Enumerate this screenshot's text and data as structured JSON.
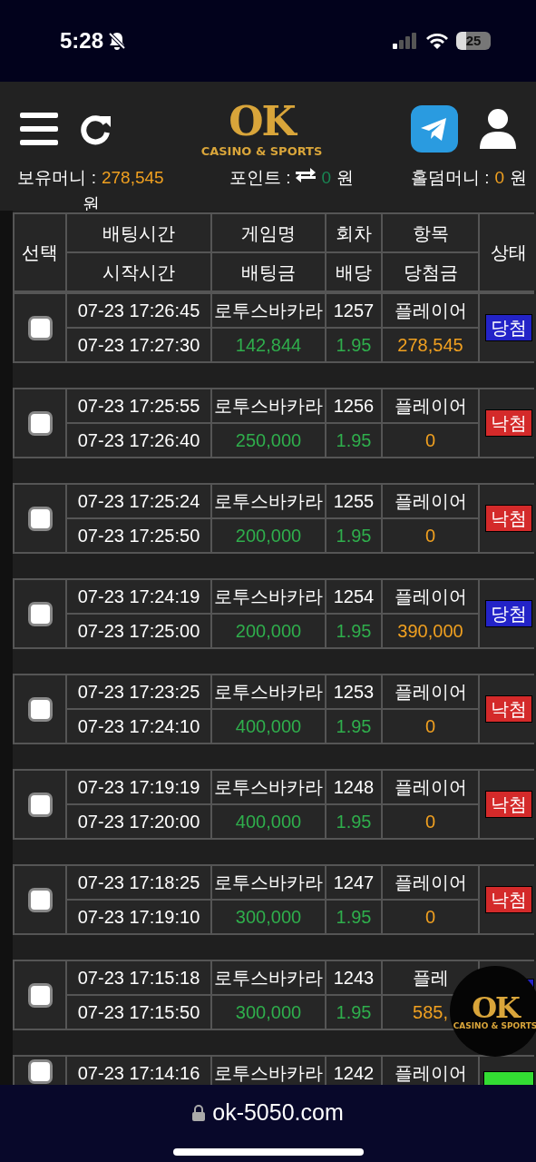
{
  "status_bar": {
    "time": "5:28",
    "battery": "25"
  },
  "header": {
    "logo": "OK",
    "logo_sub": "CASINO & SPORTS"
  },
  "balances": [
    {
      "label": "보유머니 :",
      "value": "278,545",
      "unit": "원",
      "kind": "money"
    },
    {
      "label": "포인트 :",
      "value": "0",
      "unit": "원",
      "kind": "point"
    },
    {
      "label": "홀덤머니 :",
      "value": "0",
      "unit": "원",
      "kind": "money"
    }
  ],
  "table": {
    "columns": {
      "select": "선택",
      "bet_time": "배팅시간",
      "start_time": "시작시간",
      "game": "게임명",
      "bet_amount": "배팅금",
      "round": "회차",
      "odds": "배당",
      "pick": "항목",
      "payout": "당첨금",
      "status": "상태"
    },
    "rows": [
      {
        "checked": false,
        "bet_time": "07-23 17:26:45",
        "start_time": "07-23 17:27:30",
        "game": "로투스바카라",
        "bet_amount": "142,844",
        "round": "1257",
        "odds": "1.95",
        "pick": "플레이어",
        "payout": "278,545",
        "status": {
          "kind": "win",
          "label": "당첨"
        }
      },
      {
        "checked": false,
        "bet_time": "07-23 17:25:55",
        "start_time": "07-23 17:26:40",
        "game": "로투스바카라",
        "bet_amount": "250,000",
        "round": "1256",
        "odds": "1.95",
        "pick": "플레이어",
        "payout": "0",
        "status": {
          "kind": "lose",
          "label": "낙첨"
        }
      },
      {
        "checked": false,
        "bet_time": "07-23 17:25:24",
        "start_time": "07-23 17:25:50",
        "game": "로투스바카라",
        "bet_amount": "200,000",
        "round": "1255",
        "odds": "1.95",
        "pick": "플레이어",
        "payout": "0",
        "status": {
          "kind": "lose",
          "label": "낙첨"
        }
      },
      {
        "checked": false,
        "bet_time": "07-23 17:24:19",
        "start_time": "07-23 17:25:00",
        "game": "로투스바카라",
        "bet_amount": "200,000",
        "round": "1254",
        "odds": "1.95",
        "pick": "플레이어",
        "payout": "390,000",
        "status": {
          "kind": "win",
          "label": "당첨"
        }
      },
      {
        "checked": false,
        "bet_time": "07-23 17:23:25",
        "start_time": "07-23 17:24:10",
        "game": "로투스바카라",
        "bet_amount": "400,000",
        "round": "1253",
        "odds": "1.95",
        "pick": "플레이어",
        "payout": "0",
        "status": {
          "kind": "lose",
          "label": "낙첨"
        }
      },
      {
        "checked": false,
        "bet_time": "07-23 17:19:19",
        "start_time": "07-23 17:20:00",
        "game": "로투스바카라",
        "bet_amount": "400,000",
        "round": "1248",
        "odds": "1.95",
        "pick": "플레이어",
        "payout": "0",
        "status": {
          "kind": "lose",
          "label": "낙첨"
        }
      },
      {
        "checked": false,
        "bet_time": "07-23 17:18:25",
        "start_time": "07-23 17:19:10",
        "game": "로투스바카라",
        "bet_amount": "300,000",
        "round": "1247",
        "odds": "1.95",
        "pick": "플레이어",
        "payout": "0",
        "status": {
          "kind": "lose",
          "label": "낙첨"
        }
      },
      {
        "checked": false,
        "bet_time": "07-23 17:15:18",
        "start_time": "07-23 17:15:50",
        "game": "로투스바카라",
        "bet_amount": "300,000",
        "round": "1243",
        "odds": "1.95",
        "pick": "플레",
        "payout": "585,",
        "status": {
          "kind": "win"
        }
      },
      {
        "checked": false,
        "bet_time": "07-23 17:14:16",
        "game": "로투스바카라",
        "round": "1242",
        "pick": "플레이어",
        "status": {
          "kind": "refund"
        }
      }
    ]
  },
  "floating_logo": {
    "logo": "OK",
    "logo_sub": "CASINO & SPORTS"
  },
  "browser_bar": {
    "url": "ok-5050.com"
  }
}
